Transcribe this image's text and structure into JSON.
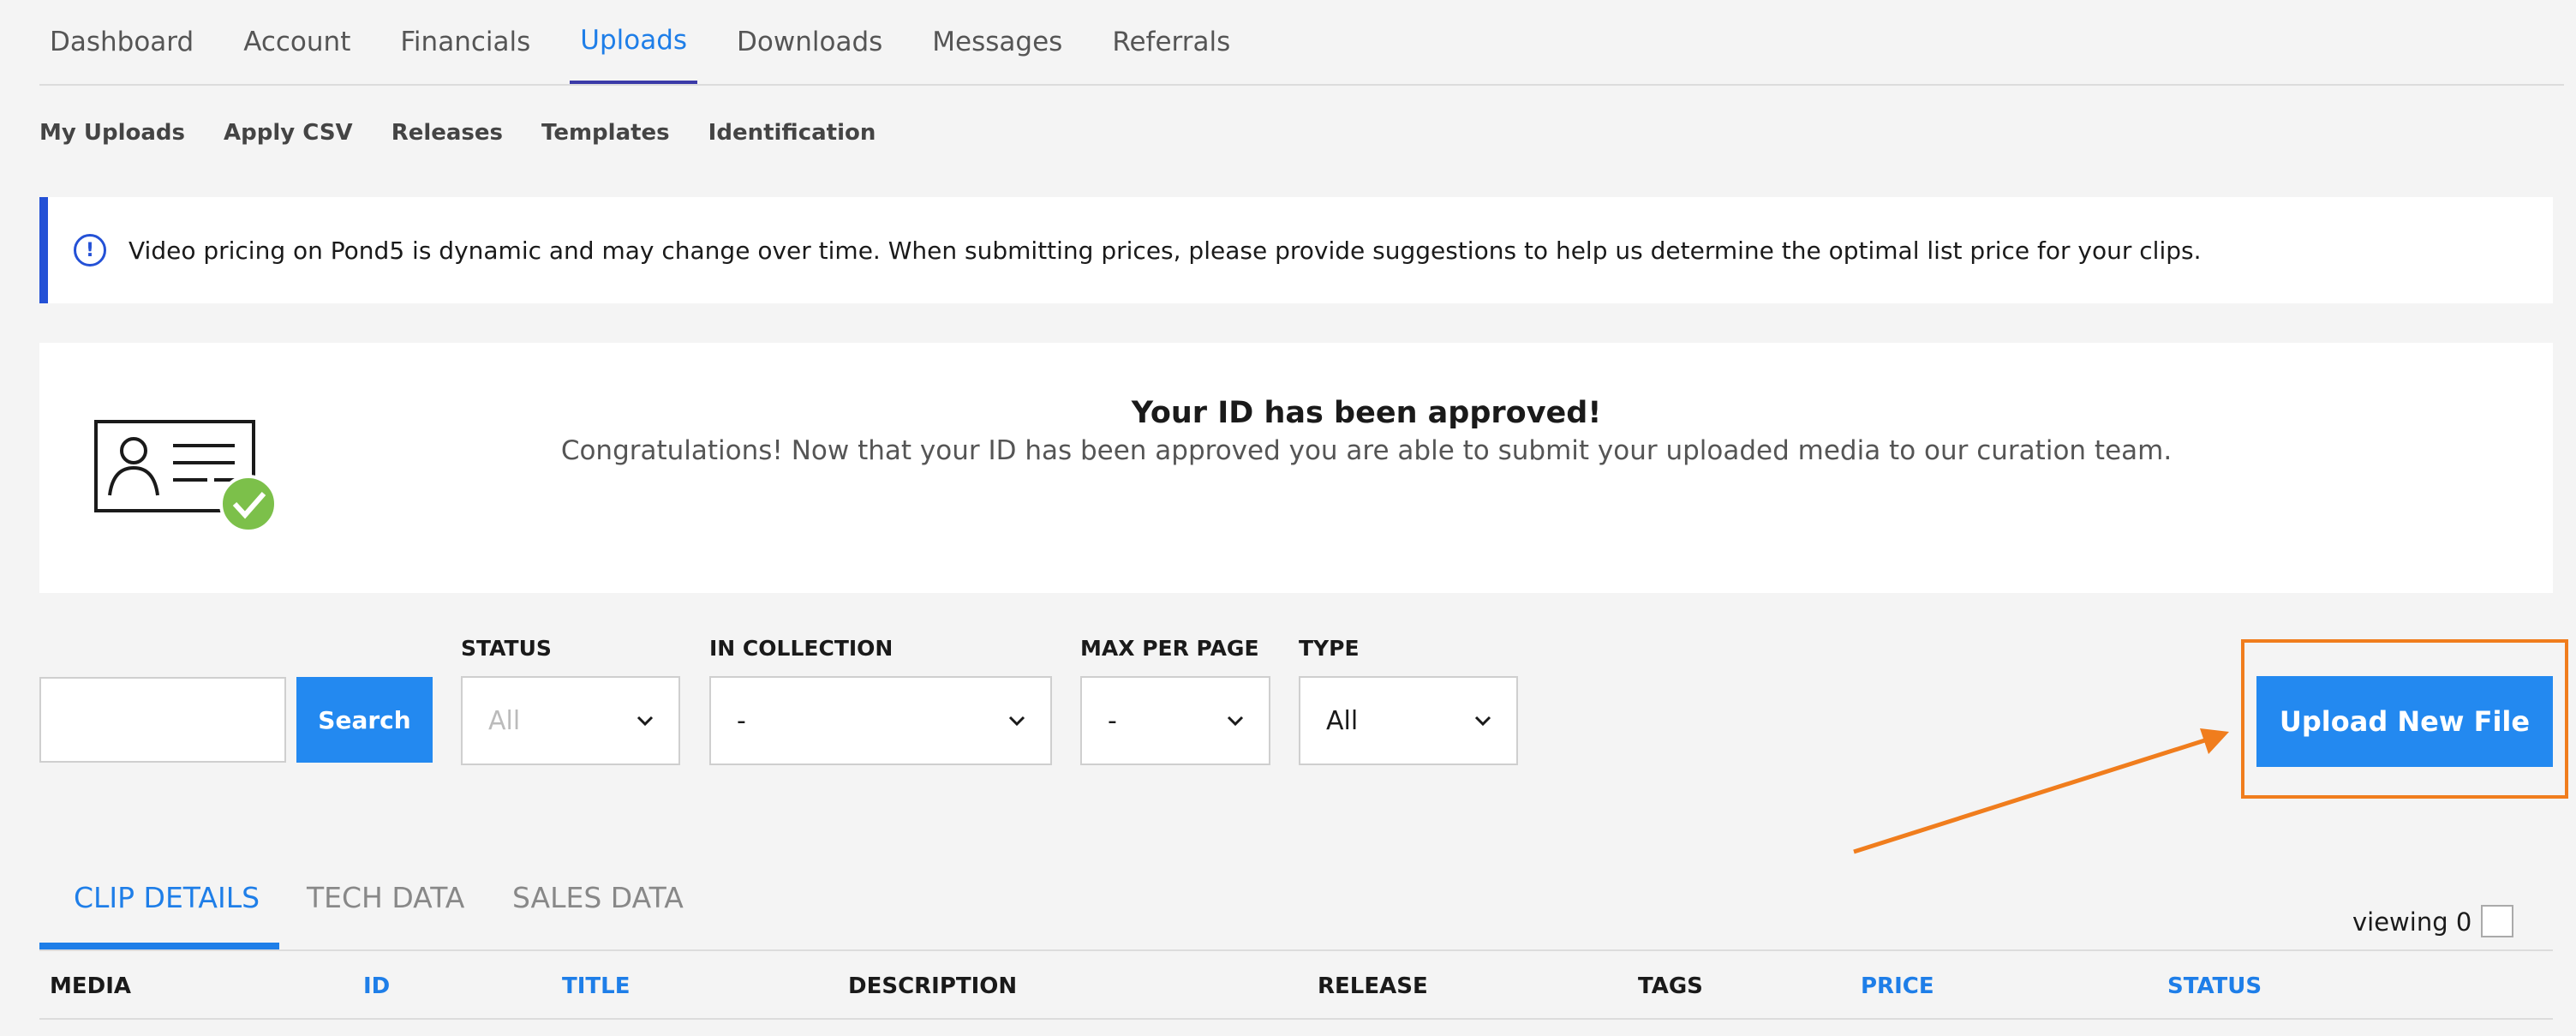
{
  "main_nav": {
    "tabs": [
      "Dashboard",
      "Account",
      "Financials",
      "Uploads",
      "Downloads",
      "Messages",
      "Referrals"
    ],
    "active": "Uploads"
  },
  "sub_nav": [
    "My Uploads",
    "Apply CSV",
    "Releases",
    "Templates",
    "Identification"
  ],
  "banner": {
    "icon": "info-icon",
    "text": "Video pricing on Pond5 is dynamic and may change over time. When submitting prices, please provide suggestions to help us determine the optimal list price for your clips."
  },
  "approval": {
    "icon": "id-card-check-icon",
    "title": "Your ID has been approved!",
    "message": "Congratulations! Now that your ID has been approved you are able to submit your uploaded media to our curation team."
  },
  "filters": {
    "search_value": "",
    "search_button": "Search",
    "status": {
      "label": "STATUS",
      "value": "All"
    },
    "collection": {
      "label": "IN COLLECTION",
      "value": "-"
    },
    "max_per_page": {
      "label": "MAX PER PAGE",
      "value": "-"
    },
    "type": {
      "label": "TYPE",
      "value": "All"
    }
  },
  "upload_button": "Upload New File",
  "data_tabs": [
    "CLIP DETAILS",
    "TECH DATA",
    "SALES DATA"
  ],
  "viewing": "viewing 0",
  "columns": [
    "MEDIA",
    "ID",
    "TITLE",
    "DESCRIPTION",
    "RELEASE",
    "TAGS",
    "PRICE",
    "STATUS"
  ],
  "colors": {
    "accent": "#1e7ee8",
    "button": "#2389f0",
    "banner_border": "#2451d6",
    "highlight": "#f07d1d",
    "check_green": "#7cc04a"
  }
}
